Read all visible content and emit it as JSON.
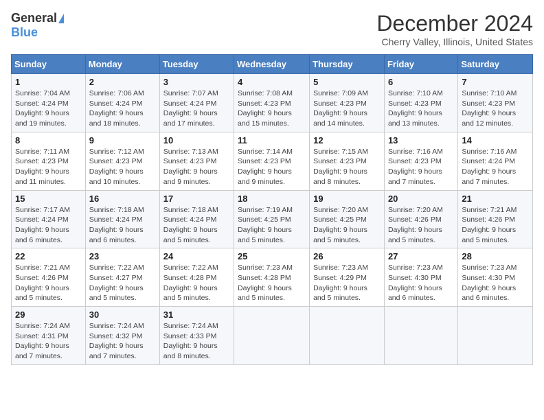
{
  "header": {
    "logo_general": "General",
    "logo_blue": "Blue",
    "month_title": "December 2024",
    "location": "Cherry Valley, Illinois, United States"
  },
  "weekdays": [
    "Sunday",
    "Monday",
    "Tuesday",
    "Wednesday",
    "Thursday",
    "Friday",
    "Saturday"
  ],
  "weeks": [
    [
      {
        "day": "1",
        "sunrise": "7:04 AM",
        "sunset": "4:24 PM",
        "daylight_hours": "9 hours",
        "daylight_minutes": "19 minutes"
      },
      {
        "day": "2",
        "sunrise": "7:06 AM",
        "sunset": "4:24 PM",
        "daylight_hours": "9 hours",
        "daylight_minutes": "18 minutes"
      },
      {
        "day": "3",
        "sunrise": "7:07 AM",
        "sunset": "4:24 PM",
        "daylight_hours": "9 hours",
        "daylight_minutes": "17 minutes"
      },
      {
        "day": "4",
        "sunrise": "7:08 AM",
        "sunset": "4:23 PM",
        "daylight_hours": "9 hours",
        "daylight_minutes": "15 minutes"
      },
      {
        "day": "5",
        "sunrise": "7:09 AM",
        "sunset": "4:23 PM",
        "daylight_hours": "9 hours",
        "daylight_minutes": "14 minutes"
      },
      {
        "day": "6",
        "sunrise": "7:10 AM",
        "sunset": "4:23 PM",
        "daylight_hours": "9 hours",
        "daylight_minutes": "13 minutes"
      },
      {
        "day": "7",
        "sunrise": "7:10 AM",
        "sunset": "4:23 PM",
        "daylight_hours": "9 hours",
        "daylight_minutes": "12 minutes"
      }
    ],
    [
      {
        "day": "8",
        "sunrise": "7:11 AM",
        "sunset": "4:23 PM",
        "daylight_hours": "9 hours",
        "daylight_minutes": "11 minutes"
      },
      {
        "day": "9",
        "sunrise": "7:12 AM",
        "sunset": "4:23 PM",
        "daylight_hours": "9 hours",
        "daylight_minutes": "10 minutes"
      },
      {
        "day": "10",
        "sunrise": "7:13 AM",
        "sunset": "4:23 PM",
        "daylight_hours": "9 hours",
        "daylight_minutes": "9 minutes"
      },
      {
        "day": "11",
        "sunrise": "7:14 AM",
        "sunset": "4:23 PM",
        "daylight_hours": "9 hours",
        "daylight_minutes": "9 minutes"
      },
      {
        "day": "12",
        "sunrise": "7:15 AM",
        "sunset": "4:23 PM",
        "daylight_hours": "9 hours",
        "daylight_minutes": "8 minutes"
      },
      {
        "day": "13",
        "sunrise": "7:16 AM",
        "sunset": "4:23 PM",
        "daylight_hours": "9 hours",
        "daylight_minutes": "7 minutes"
      },
      {
        "day": "14",
        "sunrise": "7:16 AM",
        "sunset": "4:24 PM",
        "daylight_hours": "9 hours",
        "daylight_minutes": "7 minutes"
      }
    ],
    [
      {
        "day": "15",
        "sunrise": "7:17 AM",
        "sunset": "4:24 PM",
        "daylight_hours": "9 hours",
        "daylight_minutes": "6 minutes"
      },
      {
        "day": "16",
        "sunrise": "7:18 AM",
        "sunset": "4:24 PM",
        "daylight_hours": "9 hours",
        "daylight_minutes": "6 minutes"
      },
      {
        "day": "17",
        "sunrise": "7:18 AM",
        "sunset": "4:24 PM",
        "daylight_hours": "9 hours",
        "daylight_minutes": "5 minutes"
      },
      {
        "day": "18",
        "sunrise": "7:19 AM",
        "sunset": "4:25 PM",
        "daylight_hours": "9 hours",
        "daylight_minutes": "5 minutes"
      },
      {
        "day": "19",
        "sunrise": "7:20 AM",
        "sunset": "4:25 PM",
        "daylight_hours": "9 hours",
        "daylight_minutes": "5 minutes"
      },
      {
        "day": "20",
        "sunrise": "7:20 AM",
        "sunset": "4:26 PM",
        "daylight_hours": "9 hours",
        "daylight_minutes": "5 minutes"
      },
      {
        "day": "21",
        "sunrise": "7:21 AM",
        "sunset": "4:26 PM",
        "daylight_hours": "9 hours",
        "daylight_minutes": "5 minutes"
      }
    ],
    [
      {
        "day": "22",
        "sunrise": "7:21 AM",
        "sunset": "4:26 PM",
        "daylight_hours": "9 hours",
        "daylight_minutes": "5 minutes"
      },
      {
        "day": "23",
        "sunrise": "7:22 AM",
        "sunset": "4:27 PM",
        "daylight_hours": "9 hours",
        "daylight_minutes": "5 minutes"
      },
      {
        "day": "24",
        "sunrise": "7:22 AM",
        "sunset": "4:28 PM",
        "daylight_hours": "9 hours",
        "daylight_minutes": "5 minutes"
      },
      {
        "day": "25",
        "sunrise": "7:23 AM",
        "sunset": "4:28 PM",
        "daylight_hours": "9 hours",
        "daylight_minutes": "5 minutes"
      },
      {
        "day": "26",
        "sunrise": "7:23 AM",
        "sunset": "4:29 PM",
        "daylight_hours": "9 hours",
        "daylight_minutes": "5 minutes"
      },
      {
        "day": "27",
        "sunrise": "7:23 AM",
        "sunset": "4:30 PM",
        "daylight_hours": "9 hours",
        "daylight_minutes": "6 minutes"
      },
      {
        "day": "28",
        "sunrise": "7:23 AM",
        "sunset": "4:30 PM",
        "daylight_hours": "9 hours",
        "daylight_minutes": "6 minutes"
      }
    ],
    [
      {
        "day": "29",
        "sunrise": "7:24 AM",
        "sunset": "4:31 PM",
        "daylight_hours": "9 hours",
        "daylight_minutes": "7 minutes"
      },
      {
        "day": "30",
        "sunrise": "7:24 AM",
        "sunset": "4:32 PM",
        "daylight_hours": "9 hours",
        "daylight_minutes": "7 minutes"
      },
      {
        "day": "31",
        "sunrise": "7:24 AM",
        "sunset": "4:33 PM",
        "daylight_hours": "9 hours",
        "daylight_minutes": "8 minutes"
      },
      null,
      null,
      null,
      null
    ]
  ]
}
